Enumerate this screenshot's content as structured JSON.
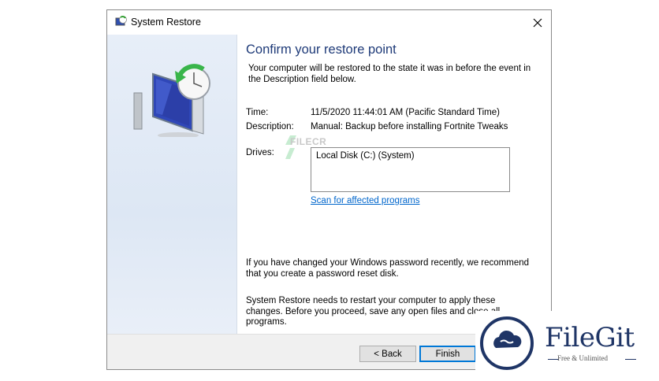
{
  "window": {
    "title": "System Restore"
  },
  "content": {
    "heading": "Confirm your restore point",
    "intro": "Your computer will be restored to the state it was in before the event in the Description field below.",
    "time_label": "Time:",
    "time_value": "11/5/2020 11:44:01 AM (Pacific Standard Time)",
    "description_label": "Description:",
    "description_value": "Manual: Backup before installing Fortnite Tweaks",
    "drives_label": "Drives:",
    "drives_value": "Local Disk (C:) (System)",
    "scan_link": "Scan for affected programs",
    "password_note": "If you have changed your Windows password recently, we recommend that you create a password reset disk.",
    "restart_note": "System Restore needs to restart your computer to apply these changes. Before you proceed, save any open files and close all programs."
  },
  "footer": {
    "back_label": "< Back",
    "finish_label": "Finish"
  },
  "watermarks": {
    "small_text": "FILECR",
    "badge_title": "FileGit",
    "badge_subtitle": "Free & Unlimited"
  },
  "colors": {
    "heading": "#1e3a78",
    "link": "#0066cc",
    "badge": "#1f3566"
  }
}
